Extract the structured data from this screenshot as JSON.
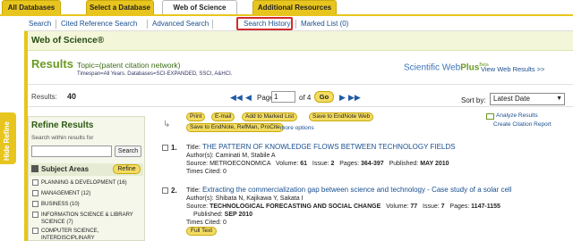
{
  "top_tabs": {
    "all_databases": "All Databases",
    "select_database": "Select a Database",
    "web_of_science": "Web of Science",
    "additional_resources": "Additional Resources"
  },
  "subnav": {
    "search": "Search",
    "cited_reference_search": "Cited Reference Search",
    "advanced_search": "Advanced Search",
    "search_history": "Search History",
    "marked_list": "Marked List (0)"
  },
  "hide_refine": "Hide Refine",
  "product_title": "Web of Science®",
  "results": {
    "heading": "Results",
    "topic": "Topic=(patent citation network)",
    "timespan": "Timespan=All Years. Databases=SCI-EXPANDED, SSCI, A&HCI.",
    "scientific": "Scientific",
    "web": "Web",
    "plus": "Plus",
    "beta": "Beta",
    "view_web_results": "View Web Results >>"
  },
  "pager": {
    "results_label": "Results:",
    "results_count": "40",
    "first_icon": "first-page-icon",
    "prev_icon": "previous-page-icon",
    "page_label": "Page",
    "page_value": "1",
    "of_label": "of 4",
    "go_label": "Go",
    "next_icon": "next-page-icon",
    "last_icon": "last-page-icon",
    "sort_label": "Sort by:",
    "sort_value": "Latest Date"
  },
  "refine": {
    "title": "Refine Results",
    "search_within_label": "Search within results for",
    "search_button": "Search",
    "subject_areas_label": "Subject Areas",
    "refine_button": "Refine",
    "items": [
      "PLANNING & DEVELOPMENT (16)",
      "MANAGEMENT (12)",
      "BUSINESS (10)",
      "INFORMATION SCIENCE & LIBRARY SCIENCE (7)",
      "COMPUTER SCIENCE, INTERDISCIPLINARY"
    ]
  },
  "actions": {
    "print": "Print",
    "email": "E-mail",
    "add_marked": "Add to Marked List",
    "save_endnote_web": "Save to EndNote Web",
    "save_endnote_refman": "Save to EndNote, RefMan, ProCite",
    "more_options": "more options",
    "analyze_results": "Analyze Results",
    "create_citation_report": "Create Citation Report"
  },
  "records": [
    {
      "num": "1.",
      "title_label": "Title:",
      "title": "THE PATTERN OF KNOWLEDGE FLOWS BETWEEN TECHNOLOGY FIELDS",
      "authors": "Author(s): Caminati M, Stabile A",
      "source_label": "Source:",
      "source": "METROECONOMICA",
      "volume_label": "Volume:",
      "volume": "61",
      "issue_label": "Issue:",
      "issue": "2",
      "pages_label": "Pages:",
      "pages": "364-397",
      "published_label": "Published:",
      "published": "MAY 2010",
      "times_cited": "Times Cited: 0"
    },
    {
      "num": "2.",
      "title_label": "Title:",
      "title": "Extracting the commercialization gap between science and technology - Case study of a solar cell",
      "authors": "Author(s): Shibata N, Kajikawa Y, Sakata I",
      "source_label": "Source:",
      "source": "TECHNOLOGICAL FORECASTING AND SOCIAL CHANGE",
      "volume_label": "Volume:",
      "volume": "77",
      "issue_label": "Issue:",
      "issue": "7",
      "pages_label": "Pages:",
      "pages": "1147-1155",
      "published_label": "Published:",
      "published": "SEP 2010",
      "times_cited": "Times Cited: 0",
      "full_text": "Full Text"
    }
  ],
  "colors": {
    "tab_yellow": "#e8c51e",
    "results_green": "#6a9b22",
    "link_blue": "#1a4f8f",
    "highlight_red": "#d32b2b"
  }
}
